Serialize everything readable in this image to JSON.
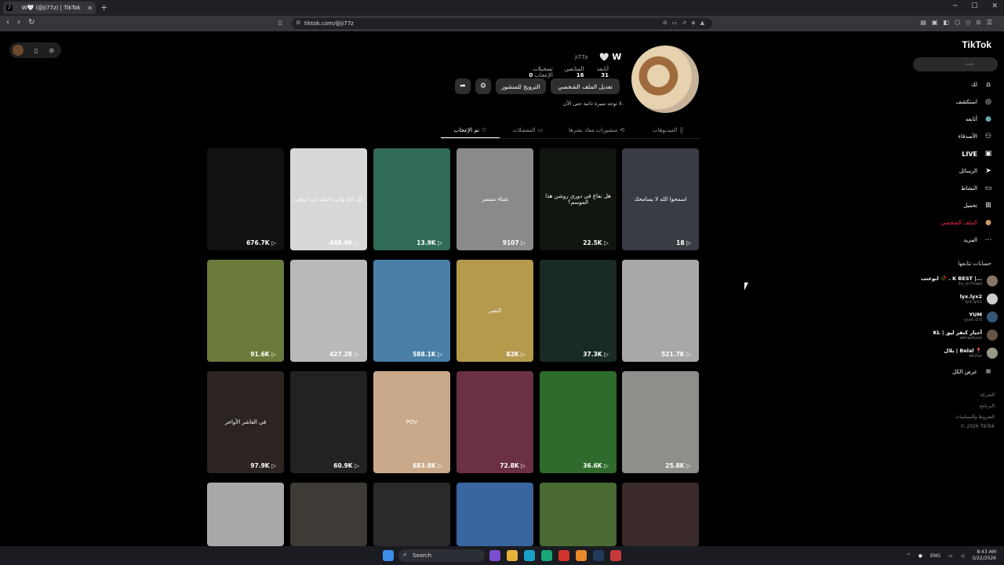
{
  "browser": {
    "tab_title": "W🤍 (@ji77z) | TikTok",
    "url": "tiktok.com/@ji77z",
    "new_tab": "+",
    "tab_close": "✕"
  },
  "sidebar": {
    "logo": "TikTok",
    "search_placeholder": "بحث",
    "nav": [
      {
        "label": "لك",
        "icon": "home-icon"
      },
      {
        "label": "استكشف",
        "icon": "compass-icon"
      },
      {
        "label": "أتابعه",
        "icon": "following-icon"
      },
      {
        "label": "الأصدقاء",
        "icon": "friends-icon"
      },
      {
        "label": "LIVE",
        "icon": "live-icon"
      },
      {
        "label": "الرسائل",
        "icon": "messages-icon"
      },
      {
        "label": "النشاط",
        "icon": "activity-icon"
      },
      {
        "label": "تحميل",
        "icon": "upload-icon"
      },
      {
        "label": "الملف الشخصي",
        "icon": "profile-icon"
      },
      {
        "label": "المزيد",
        "icon": "more-icon"
      }
    ],
    "following_header": "حسابات تتابعها",
    "following": [
      {
        "name": "ابوعتب 🥀 . K BEST |...",
        "user": "llu_m7mad"
      },
      {
        "name": "lyx.lyx2",
        "user": "lyx.lyx2"
      },
      {
        "name": "YUM",
        "user": "yum.0.0"
      },
      {
        "name": "KL | أخبار كنقز ليق",
        "user": "almaztuvo"
      },
      {
        "name": "بلال | Belal 📍",
        "user": "eh2sv"
      }
    ],
    "show_all": "عرض الكل",
    "footer": [
      "الشركة",
      "البرنامج",
      "الشروط والسياسات",
      "© 2026 TikTok"
    ]
  },
  "profile": {
    "name": "W",
    "username": "ji77z",
    "following_label": "أتابعه",
    "following_count": "31",
    "followers_label": "المتابعين",
    "followers_count": "16",
    "likes_label": "تسجيلات الإعجاب",
    "likes_count": "0",
    "edit_button": "تعديل الملف الشخصي",
    "promote_button": "الترويج للمنشور",
    "bio": "لا توجد سيرة ذاتية حتى الآن."
  },
  "tabs": [
    {
      "label": "الفيديوهات",
      "active": false
    },
    {
      "label": "منشورات معاد نشرها",
      "active": false
    },
    {
      "label": "المفضلات",
      "active": false
    },
    {
      "label": "تم الإعجاب",
      "active": true
    }
  ],
  "videos": [
    {
      "count": "676.7K",
      "color": "#111111",
      "text": ""
    },
    {
      "count": "448.9K",
      "color": "#d8d8d8",
      "text": "كل عام وانت اجمل من عرفت"
    },
    {
      "count": "13.9K",
      "color": "#2f6b55",
      "text": ""
    },
    {
      "count": "9107",
      "color": "#8a8a8a",
      "text": "شتاء منتصر"
    },
    {
      "count": "22.5K",
      "color": "#101510",
      "text": "هل نفاع في دوري روشن هذا الموسم؟"
    },
    {
      "count": "18",
      "color": "#3a3c44",
      "text": "اسمحوا الله لا يسامحك"
    },
    {
      "count": "91.6K",
      "color": "#6a7a3a",
      "text": ""
    },
    {
      "count": "427.2K",
      "color": "#b9b9b9",
      "text": ""
    },
    {
      "count": "588.1K",
      "color": "#4a7fa8",
      "text": ""
    },
    {
      "count": "82K",
      "color": "#b59a4e",
      "text": "النصر"
    },
    {
      "count": "37.3K",
      "color": "#1a2a24",
      "text": ""
    },
    {
      "count": "521.7K",
      "color": "#a8a8a8",
      "text": ""
    },
    {
      "count": "97.9K",
      "color": "#2b2420",
      "text": "في العاشر الأواخر"
    },
    {
      "count": "60.9K",
      "color": "#222222",
      "text": ""
    },
    {
      "count": "683.8K",
      "color": "#c9a98a",
      "text": "POV"
    },
    {
      "count": "72.8K",
      "color": "#6a3044",
      "text": ""
    },
    {
      "count": "36.6K",
      "color": "#2f6b2a",
      "text": ""
    },
    {
      "count": "25.8K",
      "color": "#8c8f8a",
      "text": ""
    },
    {
      "count": "",
      "color": "#a8a8a8",
      "text": ""
    },
    {
      "count": "",
      "color": "#3e3a36",
      "text": ""
    },
    {
      "count": "",
      "color": "#2a2a2a",
      "text": ""
    },
    {
      "count": "",
      "color": "#3a66a0",
      "text": ""
    },
    {
      "count": "",
      "color": "#4a6a34",
      "text": ""
    },
    {
      "count": "",
      "color": "#3b2a2a",
      "text": ""
    }
  ],
  "taskbar": {
    "search": "Search",
    "lang": "ENG",
    "time": "8:43 AM",
    "date": "3/22/2026"
  }
}
